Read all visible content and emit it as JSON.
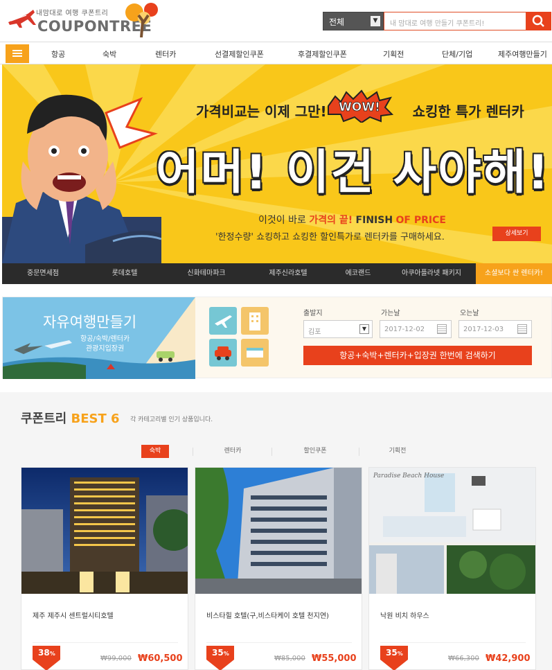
{
  "header": {
    "tagline": "내맘대로 여행 쿠폰트리",
    "logo_text": "COUPONTREE",
    "search": {
      "category": "전체",
      "placeholder": "내 맘대로 여행 만들기 쿠폰트리!"
    }
  },
  "nav": {
    "items": [
      "항공",
      "숙박",
      "렌터카",
      "선결제할인쿠폰",
      "후결제할인쿠폰",
      "기획전",
      "단체/기업",
      "제주여행만들기"
    ]
  },
  "banner": {
    "line1_left": "가격비교는 이제 그만!",
    "wow": "WOW!",
    "line1_right": "쇼킹한 특가 렌터카",
    "headline": "어머! 이건 사야해!",
    "sub1_a": "이것이 바로",
    "sub1_b": "가격의 끝!",
    "sub1_c": "FINISH",
    "sub1_d": "OF PRICE",
    "sub2": "'한정수량' 쇼킹하고 쇼킹한 할인특가로 렌터카를 구매하세요.",
    "detail_button": "상세보기",
    "tabs": [
      "중문면세점",
      "롯데호텔",
      "신화테마파크",
      "제주신라호텔",
      "에코랜드",
      "아쿠아플라넷 패키지",
      "소셜보다 싼 렌터카!"
    ],
    "active_tab": 6
  },
  "travel": {
    "title": "자유여행만들기",
    "sub_line1": "항공/숙박/렌터카",
    "sub_line2": "관광지입장권",
    "depart_label": "출발지",
    "depart_value": "김포",
    "go_label": "가는날",
    "go_value": "2017-12-02",
    "return_label": "오는날",
    "return_value": "2017-12-03",
    "search_button": "항공+숙박+렌터카+입장권 한번에 검색하기"
  },
  "best": {
    "title_a": "쿠폰트리",
    "title_b": "BEST 6",
    "desc": "각 카테고리별 인기 상품입니다.",
    "tabs": [
      "숙박",
      "렌터카",
      "할인쿠폰",
      "기획전"
    ],
    "active_tab": 0,
    "cards": [
      {
        "name": "제주 제주시 센트럴시티호텔",
        "discount": "38",
        "old_price": "₩99,000",
        "new_price": "₩60,500",
        "caption": ""
      },
      {
        "name": "비스타힐 호텔(구,비스타케이 호텔 천지연)",
        "discount": "35",
        "old_price": "₩85,000",
        "new_price": "₩55,000",
        "caption": ""
      },
      {
        "name": "낙원 비치 하우스",
        "discount": "35",
        "old_price": "₩66,300",
        "new_price": "₩42,900",
        "caption": "Paradise Beach House"
      }
    ]
  },
  "colors": {
    "accent": "#e8411c",
    "orange": "#f7a21b",
    "banner_bg": "#f9c71a"
  }
}
